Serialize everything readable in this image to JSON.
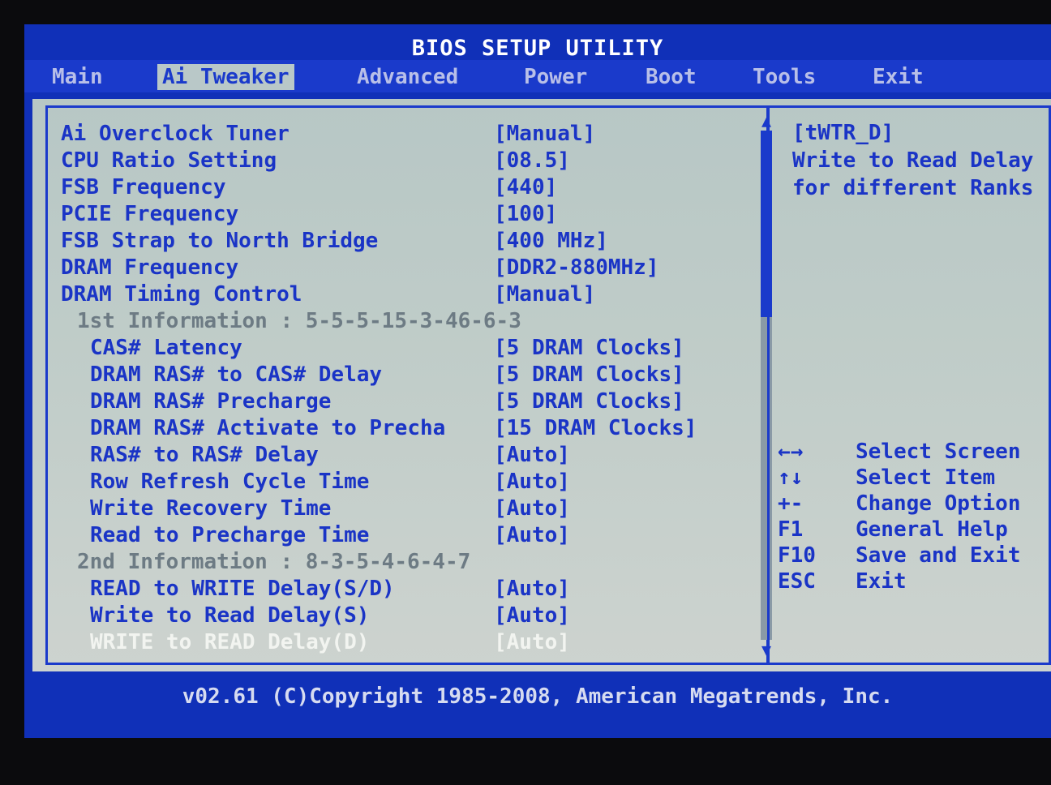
{
  "title": "BIOS SETUP UTILITY",
  "menu": [
    {
      "label": "Main"
    },
    {
      "label": "Ai Tweaker",
      "active": true
    },
    {
      "label": "Advanced"
    },
    {
      "label": "Power"
    },
    {
      "label": "Boot"
    },
    {
      "label": "Tools"
    },
    {
      "label": "Exit"
    }
  ],
  "settings": [
    {
      "label": "Ai Overclock Tuner",
      "value": "[Manual]"
    },
    {
      "label": "CPU Ratio Setting",
      "value": "[08.5]"
    },
    {
      "label": "FSB Frequency",
      "value": "[440]"
    },
    {
      "label": "PCIE Frequency",
      "value": "[100]"
    },
    {
      "label": "FSB Strap to North Bridge",
      "value": "[400 MHz]"
    },
    {
      "label": "DRAM Frequency",
      "value": "[DDR2-880MHz]"
    },
    {
      "label": "DRAM Timing Control",
      "value": "[Manual]"
    },
    {
      "label": "1st Information : 5-5-5-15-3-46-6-3",
      "value": "",
      "type": "info"
    },
    {
      "label": "CAS# Latency",
      "value": "[5 DRAM Clocks]",
      "type": "sub"
    },
    {
      "label": "DRAM RAS# to CAS# Delay",
      "value": "[5 DRAM Clocks]",
      "type": "sub"
    },
    {
      "label": "DRAM RAS# Precharge",
      "value": "[5 DRAM Clocks]",
      "type": "sub"
    },
    {
      "label": "DRAM RAS# Activate to Precha",
      "value": "[15 DRAM Clocks]",
      "type": "sub"
    },
    {
      "label": "RAS# to RAS# Delay",
      "value": "[Auto]",
      "type": "sub"
    },
    {
      "label": "Row Refresh Cycle Time",
      "value": "[Auto]",
      "type": "sub"
    },
    {
      "label": "Write Recovery Time",
      "value": "[Auto]",
      "type": "sub"
    },
    {
      "label": "Read to Precharge Time",
      "value": "[Auto]",
      "type": "sub"
    },
    {
      "label": "2nd Information : 8-3-5-4-6-4-7",
      "value": "",
      "type": "info"
    },
    {
      "label": "READ to WRITE Delay(S/D)",
      "value": "[Auto]",
      "type": "sub"
    },
    {
      "label": "Write to Read Delay(S)",
      "value": "[Auto]",
      "type": "sub"
    },
    {
      "label": "WRITE to READ Delay(D)",
      "value": "[Auto]",
      "type": "sub",
      "selected": true
    }
  ],
  "help": {
    "title": "[tWTR_D]",
    "lines": [
      "Write to Read Delay",
      "for different Ranks"
    ]
  },
  "keys": [
    {
      "key": "←→",
      "desc": "Select Screen"
    },
    {
      "key": "↑↓",
      "desc": "Select Item"
    },
    {
      "key": "+-",
      "desc": "Change Option"
    },
    {
      "key": "F1",
      "desc": "General Help"
    },
    {
      "key": "F10",
      "desc": "Save and Exit"
    },
    {
      "key": "ESC",
      "desc": "Exit"
    }
  ],
  "footer": "v02.61 (C)Copyright 1985-2008, American Megatrends, Inc.",
  "colors": {
    "background_blue": "#1030b8",
    "panel_gray": "#c1cdc9",
    "text_blue": "#1a34c6",
    "info_gray": "#6d7b84",
    "selected_white": "#f2f4f0"
  }
}
